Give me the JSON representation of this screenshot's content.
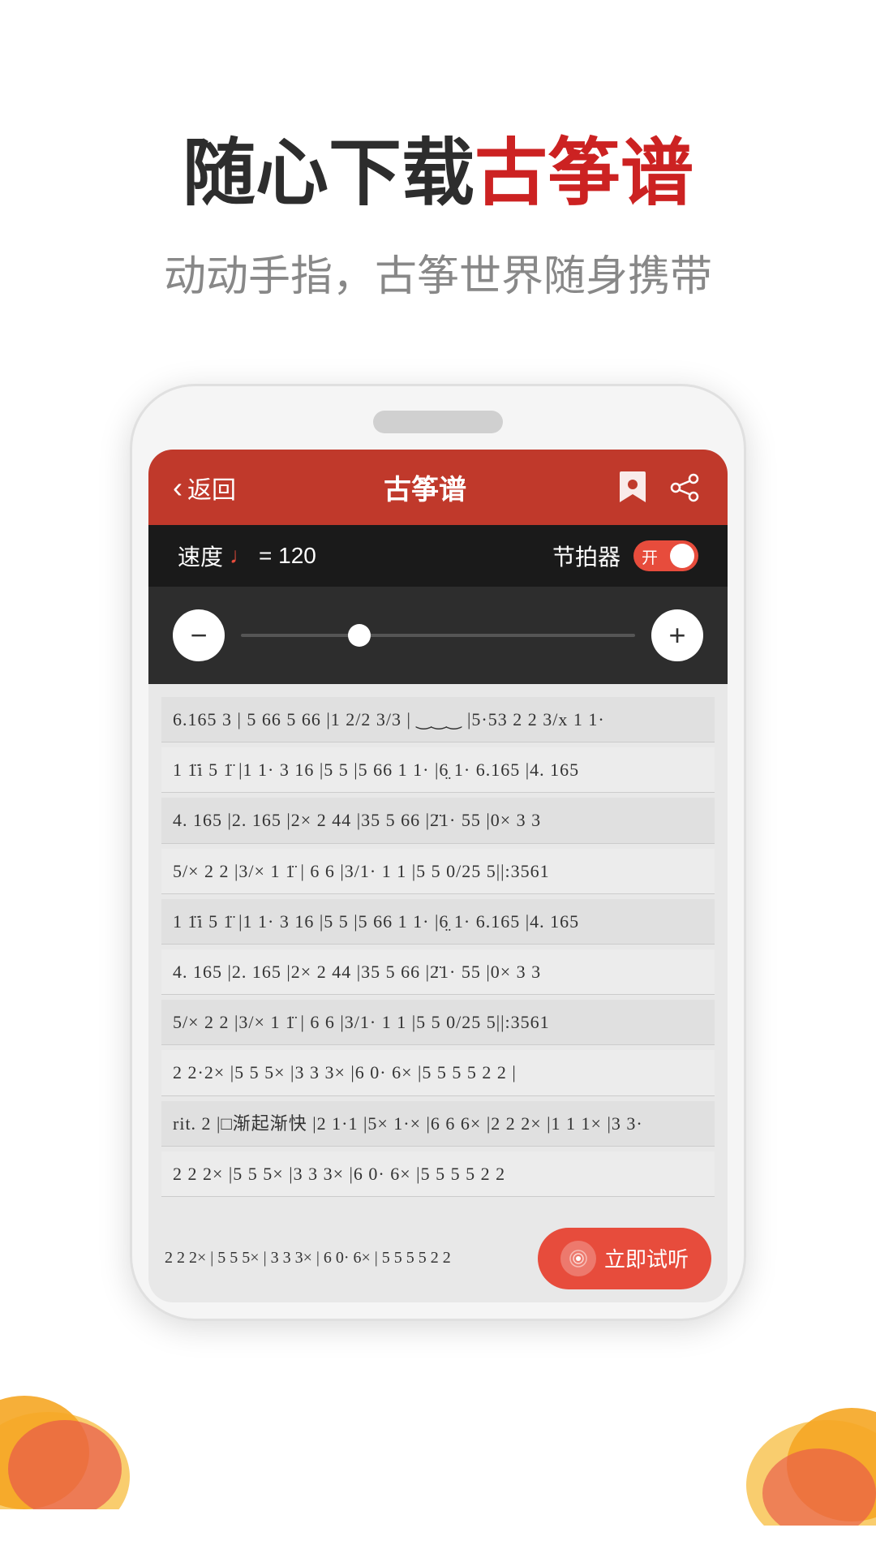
{
  "page": {
    "background_color": "#ffffff"
  },
  "headline": {
    "main_text_1": "随心下载",
    "main_text_2": "古筝谱",
    "main_text_2_color": "#cc2222",
    "sub_text": "动动手指，古筝世界随身携带"
  },
  "app": {
    "header": {
      "back_label": "返回",
      "title": "古筝谱"
    },
    "tempo_bar": {
      "speed_label": "速度",
      "tempo_value": "= 120",
      "metronome_label": "节拍器",
      "toggle_label": "开",
      "toggle_on": true
    },
    "slider": {
      "minus_label": "−",
      "plus_label": "+"
    },
    "sheet_rows": [
      "6.165 3  |  5 66 5 66  |1  2/2  3/3  | ‿‿‿ |5·53 2 2 3/x  1 1·",
      "1 1̈i  5 1̈  |1 1·  3 16  |5  5  |5 66 1 1·  |6̤ 1·  6.165 |4.   165",
      "4.   165 |2.   165 |2×  2 44 |35  5  66 |2̈1·  55  |0×  3 3",
      "5/×  2 2  |3/×  1  1̈  |  6 6  |3/1·  1 1  |5 5  0/25  5||:3561",
      "1 1̈i  5 1̈  |1 1·  3 16  |5    5  |5 66 1 1·  |6̤ 1·  6.165  |4.   165",
      "4.   165 |2.   165 |2×  2 44 |35  5  66 |2̈1·  55  |0×  3 3",
      "5/×  2 2  |3/×  1  1̈  |  6 6  |3/1·  1 1  |5 5  0/25  5||:3561",
      "2 2·2×  |5 5  5×  |3 3  3×  |6 0·  6×  |5 5  5 5 2 2  |",
      "rit.  2  |□渐起渐快  |2 1·1  |5×  1·×  |6 6  6×  |2 2  2×  |1 1  1×  |3 3·",
      "2 2  2×  |5 5  5×  |3 3  3×  |6 0·  6×  |5 5  5 5 2 2"
    ],
    "listen_button": {
      "label": "立即试听"
    }
  },
  "decorations": {
    "blob_colors": [
      "#f5a623",
      "#e8584a",
      "#f7c04a"
    ]
  }
}
